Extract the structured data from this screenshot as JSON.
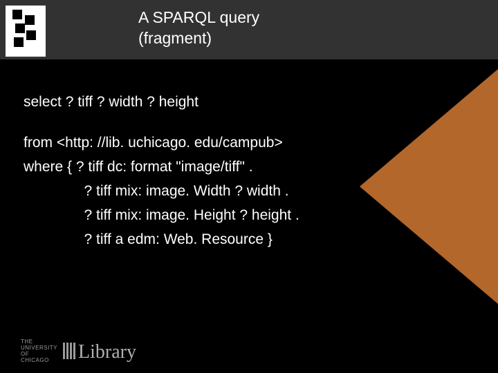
{
  "title_line1": "A SPARQL query",
  "title_line2": "(fragment)",
  "query": {
    "l1": "select ? tiff ? width ? height",
    "l2": "from <http: //lib. uchicago. edu/campub>",
    "l3": "where { ? tiff dc: format \"image/tiff\" .",
    "l4": "               ? tiff mix: image. Width ? width .",
    "l5": "               ? tiff mix: image. Height ? height .",
    "l6": "               ? tiff a edm: Web. Resource }"
  },
  "footer": {
    "uni_l1": "THE",
    "uni_l2": "UNIVERSITY",
    "uni_l3": "OF",
    "uni_l4": "CHICAGO",
    "library": "Library"
  }
}
